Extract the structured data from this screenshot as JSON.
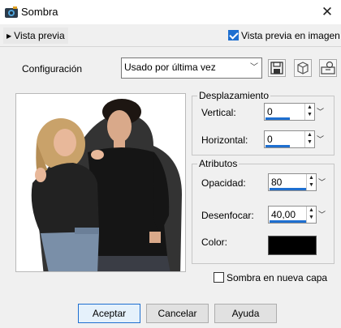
{
  "window": {
    "title": "Sombra"
  },
  "preview_toggle": {
    "label": "Vista previa"
  },
  "preview_checkbox": {
    "label": "Vista previa en imagen",
    "checked": true
  },
  "config": {
    "label": "Configuración",
    "selected": "Usado por última vez"
  },
  "offset_group": {
    "title": "Desplazamiento",
    "vertical": {
      "label": "Vertical:",
      "value": "0",
      "slider_fraction": 0.5
    },
    "horizontal": {
      "label": "Horizontal:",
      "value": "0",
      "slider_fraction": 0.5
    }
  },
  "attributes_group": {
    "title": "Atributos",
    "opacity": {
      "label": "Opacidad:",
      "value": "80",
      "slider_fraction": 0.8
    },
    "blur": {
      "label": "Desenfocar:",
      "value": "40,00",
      "slider_fraction": 0.8
    },
    "color": {
      "label": "Color:",
      "value": "#000000"
    }
  },
  "new_layer_checkbox": {
    "label": "Sombra en nueva capa",
    "checked": false
  },
  "buttons": {
    "ok": "Aceptar",
    "cancel": "Cancelar",
    "help": "Ayuda"
  },
  "colors": {
    "accent": "#1e6fd0",
    "shadow_color": "#000000"
  }
}
